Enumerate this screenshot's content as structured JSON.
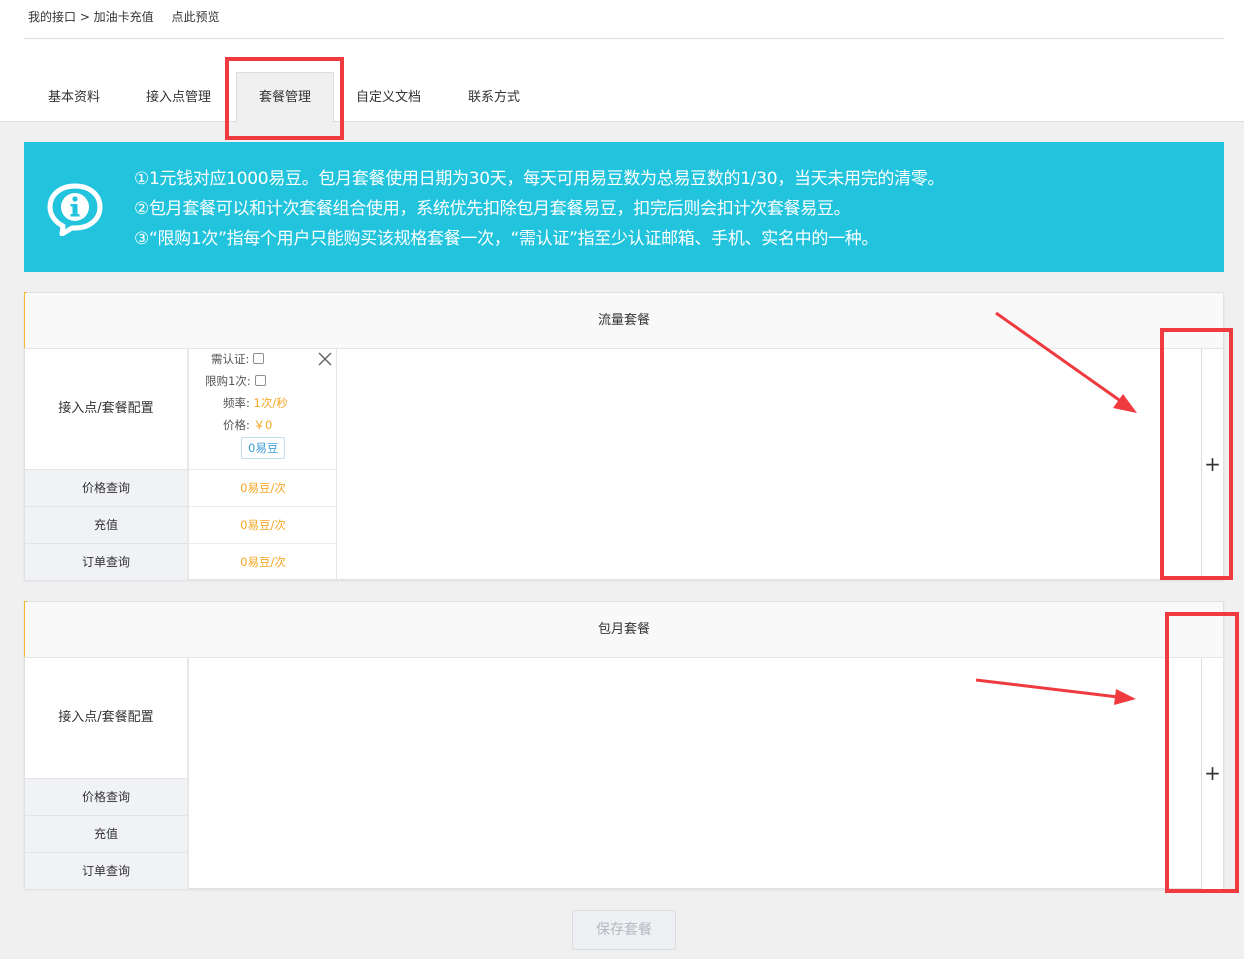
{
  "breadcrumb": {
    "path": "我的接口 > 加油卡充值",
    "preview": "点此预览"
  },
  "tabs": [
    {
      "label": "基本资料",
      "active": false
    },
    {
      "label": "接入点管理",
      "active": false
    },
    {
      "label": "套餐管理",
      "active": true
    },
    {
      "label": "自定义文档",
      "active": false
    },
    {
      "label": "联系方式",
      "active": false
    }
  ],
  "notice": {
    "icon": "info-icon",
    "lines": [
      "①1元钱对应1000易豆。包月套餐使用日期为30天，每天可用易豆数为总易豆数的1/30，当天未用完的清零。",
      "②包月套餐可以和计次套餐组合使用，系统优先扣除包月套餐易豆，扣完后则会扣计次套餐易豆。",
      "③“限购1次”指每个用户只能购买该规格套餐一次，“需认证”指至少认证邮箱、手机、实名中的一种。"
    ]
  },
  "panels": [
    {
      "title": "流量套餐",
      "config_label": "接入点/套餐配置",
      "rows": [
        "价格查询",
        "充值",
        "订单查询"
      ],
      "package": {
        "cert_label": "需认证:",
        "cert_checked": false,
        "limit_label": "限购1次:",
        "limit_checked": false,
        "rate_label": "频率:",
        "rate_value": "1次/秒",
        "price_label": "价格:",
        "price_value": "￥0",
        "beans": "0易豆",
        "row_values": [
          "0易豆/次",
          "0易豆/次",
          "0易豆/次"
        ]
      },
      "add_label": "+"
    },
    {
      "title": "包月套餐",
      "config_label": "接入点/套餐配置",
      "rows": [
        "价格查询",
        "充值",
        "订单查询"
      ],
      "add_label": "+"
    }
  ],
  "save_button": "保存套餐",
  "colors": {
    "notice_bg": "#22c4dd",
    "accent_orange": "#f5a623",
    "panel_marker": "#f5b82e",
    "annotation_red": "#ef3a3f",
    "pill_blue": "#3d9ad6"
  }
}
